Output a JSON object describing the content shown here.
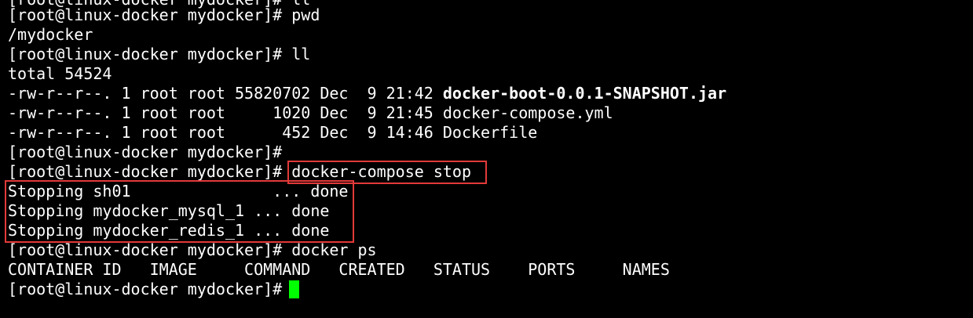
{
  "terminal": {
    "lines": [
      "[root@linux-docker mydocker]# pwd",
      "/mydocker",
      "[root@linux-docker mydocker]# ll",
      "total 54524",
      "[root@linux-docker mydocker]#",
      "[root@linux-docker mydocker]# ",
      "Stopping sh01               ... done",
      "Stopping mydocker_mysql_1 ... done",
      "Stopping mydocker_redis_1 ... done",
      "[root@linux-docker mydocker]# docker ps",
      "CONTAINER ID   IMAGE     COMMAND   CREATED   STATUS    PORTS     NAMES",
      "[root@linux-docker mydocker]# "
    ],
    "top_partial": "[root@linux-docker mydocker]# ll",
    "files": [
      {
        "meta": "-rw-r--r--. 1 root root 55820702 Dec  9 21:42 ",
        "name": "docker-boot-0.0.1-SNAPSHOT.jar"
      },
      {
        "meta": "-rw-r--r--. 1 root root     1020 Dec  9 21:45 ",
        "name": "docker-compose.yml"
      },
      {
        "meta": "-rw-r--r--. 1 root root      452 Dec  9 14:46 ",
        "name": "Dockerfile"
      }
    ],
    "highlighted_command": "docker-compose stop",
    "accent_box_color": "#e23a3a",
    "cursor_color": "#00ff00"
  }
}
